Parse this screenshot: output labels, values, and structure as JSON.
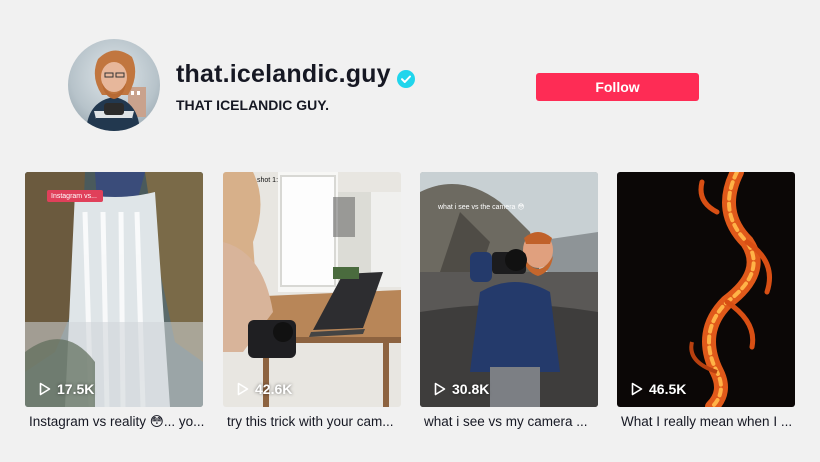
{
  "profile": {
    "username": "that.icelandic.guy",
    "nickname": "THAT ICELANDIC GUY.",
    "verified_icon": "verified-check-icon",
    "follow_label": "Follow"
  },
  "colors": {
    "accent": "#fe2c55",
    "verified": "#20d5ec",
    "background": "#f1f1f1"
  },
  "videos": [
    {
      "views": "17.5K",
      "caption": "Instagram vs reality 😳... yo...",
      "overlay": "Instagram vs..."
    },
    {
      "views": "42.6K",
      "caption": "try this trick with your cam...",
      "overlay": "shot 1:"
    },
    {
      "views": "30.8K",
      "caption": "what i see vs my camera ...",
      "overlay": "what i see vs the camera 😳"
    },
    {
      "views": "46.5K",
      "caption": "What I really mean when I ...",
      "overlay": ""
    }
  ]
}
